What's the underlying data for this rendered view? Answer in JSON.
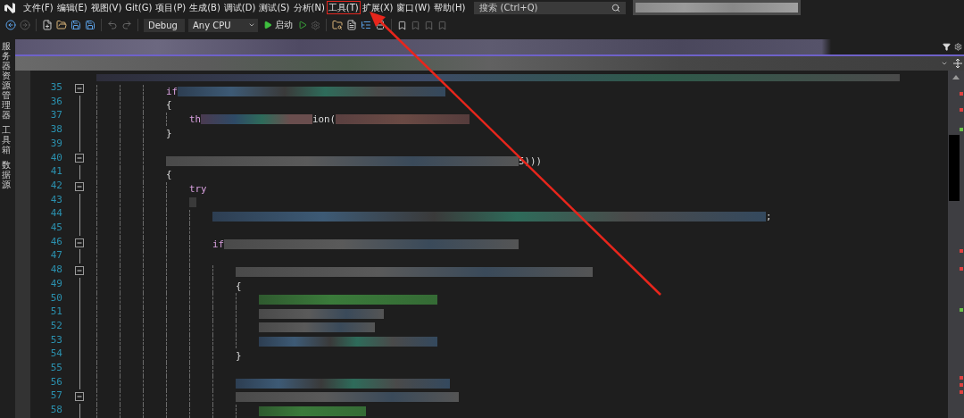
{
  "menu": {
    "items": [
      {
        "label": "文件(F)",
        "highlighted": false
      },
      {
        "label": "编辑(E)",
        "highlighted": false
      },
      {
        "label": "视图(V)",
        "highlighted": false
      },
      {
        "label": "Git(G)",
        "highlighted": false
      },
      {
        "label": "项目(P)",
        "highlighted": false
      },
      {
        "label": "生成(B)",
        "highlighted": false
      },
      {
        "label": "调试(D)",
        "highlighted": false
      },
      {
        "label": "测试(S)",
        "highlighted": false
      },
      {
        "label": "分析(N)",
        "highlighted": false
      },
      {
        "label": "工具(T)",
        "highlighted": true
      },
      {
        "label": "扩展(X)",
        "highlighted": false
      },
      {
        "label": "窗口(W)",
        "highlighted": false
      },
      {
        "label": "帮助(H)",
        "highlighted": false
      }
    ]
  },
  "search": {
    "placeholder": "搜索 (Ctrl+Q)"
  },
  "toolbar": {
    "configuration": "Debug",
    "platform": "Any CPU",
    "start_label": "启动"
  },
  "side_tabs": [
    "服务器资源管理器",
    "工具箱",
    "数据源"
  ],
  "editor": {
    "lines": [
      {
        "number": "35",
        "code": "if",
        "foldable": true
      },
      {
        "number": "36",
        "code": "{",
        "foldable": false
      },
      {
        "number": "37",
        "code": "th",
        "code_2": "ion(",
        "foldable": false
      },
      {
        "number": "38",
        "code": "}",
        "foldable": false
      },
      {
        "number": "39",
        "foldable": false
      },
      {
        "number": "40",
        "code_2": "5)))",
        "foldable": true
      },
      {
        "number": "41",
        "code": "{",
        "foldable": false
      },
      {
        "number": "42",
        "code": "try",
        "foldable": true
      },
      {
        "number": "43",
        "foldable": false
      },
      {
        "number": "44",
        "code_2": ";",
        "foldable": false
      },
      {
        "number": "45",
        "foldable": false
      },
      {
        "number": "46",
        "code": "if",
        "foldable": true
      },
      {
        "number": "47",
        "foldable": false
      },
      {
        "number": "48",
        "foldable": true
      },
      {
        "number": "49",
        "code": "{",
        "foldable": false
      },
      {
        "number": "50",
        "foldable": false
      },
      {
        "number": "51",
        "foldable": false
      },
      {
        "number": "52",
        "foldable": false
      },
      {
        "number": "53",
        "foldable": false
      },
      {
        "number": "54",
        "code": "}",
        "foldable": false
      },
      {
        "number": "55",
        "foldable": false
      },
      {
        "number": "56",
        "foldable": false
      },
      {
        "number": "57",
        "foldable": true
      },
      {
        "number": "58",
        "foldable": false
      }
    ]
  }
}
